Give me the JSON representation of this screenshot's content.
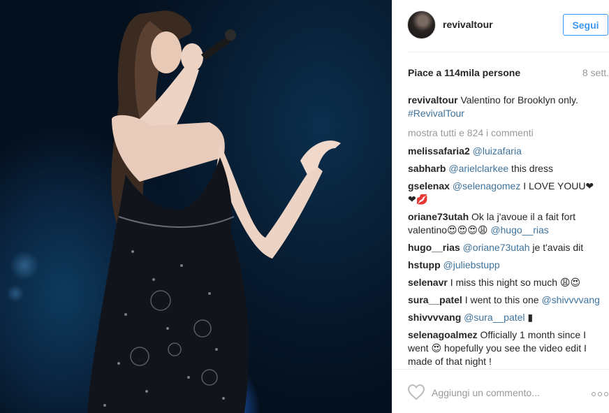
{
  "post": {
    "username": "revivaltour",
    "follow_label": "Segui",
    "likes_prefix": "Piace a ",
    "likes_count": "114mila",
    "likes_suffix": " persone",
    "time_ago": "8 sett.",
    "caption": {
      "user": "revivaltour",
      "text": " Valentino for Brooklyn only.",
      "hashtag": "#RevivalTour"
    },
    "show_all_comments": "mostra tutti e 824 i commenti",
    "comments": [
      {
        "user": "melissafaria2",
        "mention": "@luizafaria",
        "text": ""
      },
      {
        "user": "sabharb",
        "mention": "@arielclarkee",
        "text": " this dress"
      },
      {
        "user": "gselenax",
        "mention": "@selenagomez",
        "text": " I LOVE YOUU❤❤💋"
      },
      {
        "user": "oriane73utah",
        "text": " Ok la j'avoue il a fait fort valentino😍😍😍😩 ",
        "mention": "@hugo__rias"
      },
      {
        "user": "hugo__rias",
        "mention": "@oriane73utah",
        "text": " je t'avais dit"
      },
      {
        "user": "hstupp",
        "mention": "@juliebstupp",
        "text": ""
      },
      {
        "user": "selenavr",
        "text": " I miss this night so much 😩😍"
      },
      {
        "user": "sura__patel",
        "text": " I went to this one ",
        "mention": "@shivvvvang"
      },
      {
        "user": "shivvvvang",
        "mention": "@sura__patel",
        "text": " ▮"
      },
      {
        "user": "selenagoalmez",
        "text": " Officially 1 month since I went 😍 hopefully you see the video edit I made of that night !"
      }
    ],
    "add_comment_placeholder": "Aggiungi un commento...",
    "icons": {
      "like": "heart-icon",
      "more": "more-options-icon"
    }
  },
  "colors": {
    "accent": "#3897f0",
    "mention": "#3f729b",
    "muted": "#999999"
  }
}
